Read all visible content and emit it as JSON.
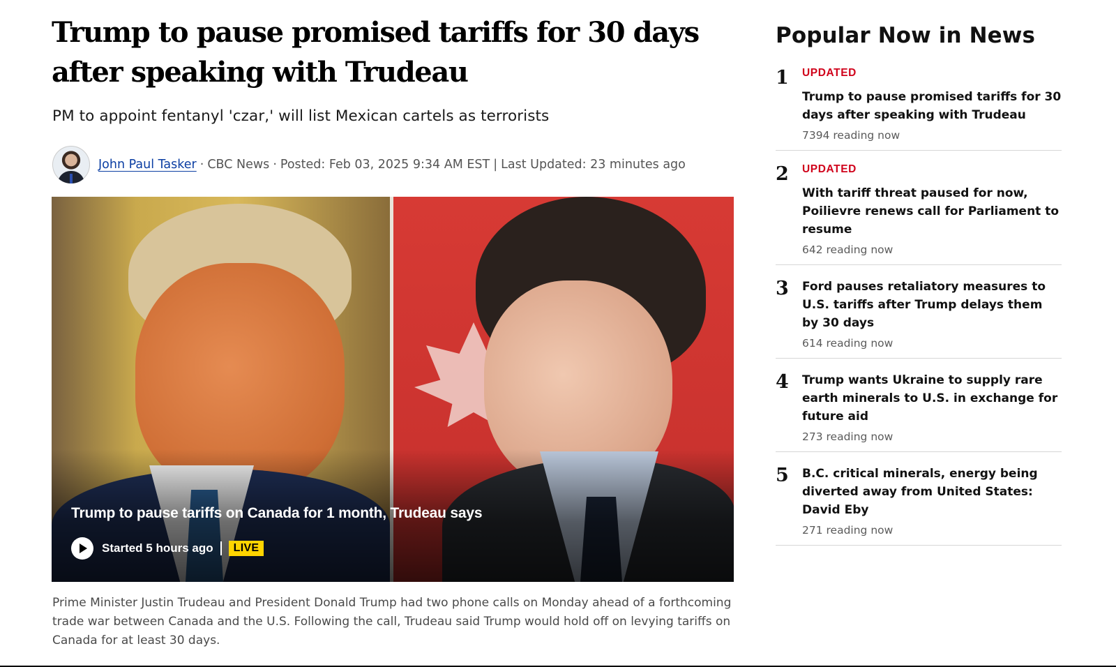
{
  "article": {
    "headline": "Trump to pause promised tariffs for 30 days after speaking with Trudeau",
    "deck": "PM to appoint fentanyl 'czar,' will list Mexican cartels as terrorists",
    "byline": {
      "author": "John Paul Tasker",
      "outlet": "CBC News",
      "posted": "Posted: Feb 03, 2025 9:34 AM EST",
      "updated": "Last Updated: 23 minutes ago"
    },
    "video": {
      "caption": "Trump to pause tariffs on Canada for 1 month, Trudeau says",
      "started": "Started 5 hours ago",
      "badge": "LIVE"
    },
    "summary": "Prime Minister Justin Trudeau and President Donald Trump had two phone calls on Monday ahead of a forthcoming trade war between Canada and the U.S. Following the call, Trudeau said Trump would hold off on levying tariffs on Canada for at least 30 days."
  },
  "sidebar": {
    "title": "Popular Now in News",
    "items": [
      {
        "rank": "1",
        "badge": "UPDATED",
        "title": "Trump to pause promised tariffs for 30 days after speaking with Trudeau",
        "count": "7394 reading now"
      },
      {
        "rank": "2",
        "badge": "UPDATED",
        "title": "With tariff threat paused for now, Poilievre renews call for Parliament to resume",
        "count": "642 reading now"
      },
      {
        "rank": "3",
        "badge": "",
        "title": "Ford pauses retaliatory measures to U.S. tariffs after Trump delays them by 30 days",
        "count": "614 reading now"
      },
      {
        "rank": "4",
        "badge": "",
        "title": "Trump wants Ukraine to supply rare earth minerals to U.S. in exchange for future aid",
        "count": "273 reading now"
      },
      {
        "rank": "5",
        "badge": "",
        "title": "B.C. critical minerals, energy being diverted away from United States: David Eby",
        "count": "271 reading now"
      }
    ]
  },
  "colors": {
    "badge_red": "#d0021b",
    "live_yellow": "#ffd400",
    "author_link": "#0b3ea3"
  }
}
